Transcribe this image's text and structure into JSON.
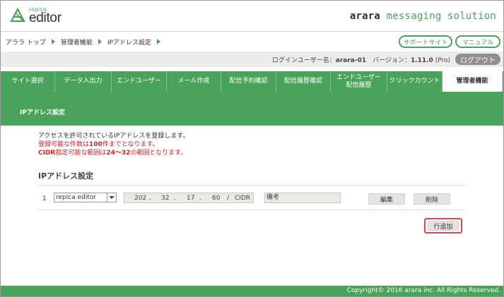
{
  "header": {
    "logo_small": "repica",
    "logo_big": "editor",
    "brand_bold": "arara",
    "brand_rest": " messaging solution"
  },
  "breadcrumb": [
    "アララ トップ",
    "管理者機能",
    "IPアドレス設定"
  ],
  "top_links": {
    "support": "サポートサイト",
    "manual": "マニュアル"
  },
  "login": {
    "label": "ログインユーザー名：",
    "user": "arara-01",
    "version_label": "　バージョン：",
    "version": "1.11.0",
    "edition": " (Pro)",
    "logout": "ログアウト"
  },
  "nav": {
    "tabs": [
      {
        "label": "サイト選択"
      },
      {
        "label": "データ入出力"
      },
      {
        "label": "エンドユーザー"
      },
      {
        "label": "メール作成"
      },
      {
        "label": "配信予約確認"
      },
      {
        "label": "配信履歴確認"
      },
      {
        "label": "エンドユーザー\n配信履歴"
      },
      {
        "label": "クリックカウント"
      },
      {
        "label": "管理者機能"
      }
    ],
    "active_index": 8
  },
  "section": {
    "title": "IPアドレス設定"
  },
  "intro": {
    "line1": "アクセスを許可されているIPアドレスを登録します。",
    "line2_pre": "登録可能な件数は",
    "line2_num": "100",
    "line2_post": "件までとなります。",
    "line3_pre": "CIDR",
    "line3_mid": "指定可能な範囲は",
    "line3_num": "24～32",
    "line3_post": "の範囲となります。"
  },
  "ip_settings": {
    "heading": "IPアドレス設定",
    "rows": [
      {
        "index": "1",
        "site": "repica editor",
        "octet1": "202",
        "octet2": "32",
        "octet3": "17",
        "octet4": "60",
        "cidr_label": "CIDR",
        "dot": ".",
        "slash": "/",
        "memo_placeholder": "備考",
        "edit": "編集",
        "delete": "削除"
      }
    ],
    "add_row": "行追加"
  },
  "footer": {
    "copyright": "Copyright© 2016 arara inc. All Rights Reserved."
  },
  "colors": {
    "green": "#4aa35a",
    "red": "#e02020",
    "logout_gray": "#8f8f8f"
  }
}
